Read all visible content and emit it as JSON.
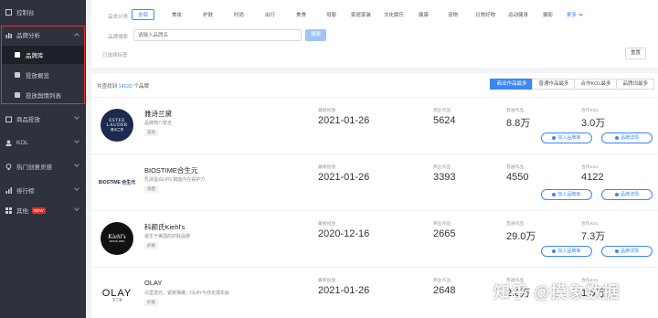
{
  "sidebar": {
    "items": [
      {
        "label": "控制台"
      },
      {
        "label": "品牌分析"
      },
      {
        "label": "品牌库"
      },
      {
        "label": "投放概览"
      },
      {
        "label": "投放舆情列表"
      },
      {
        "label": "商品投放"
      },
      {
        "label": "KOL"
      },
      {
        "label": "热门创意灵感"
      },
      {
        "label": "排行榜"
      },
      {
        "label": "其他",
        "badge": "NEW"
      }
    ]
  },
  "filters": {
    "category_label": "品类分类",
    "categories": [
      "全部",
      "美妆",
      "护肤",
      "时尚",
      "出行",
      "美食",
      "母婴",
      "家居家装",
      "文化娱乐",
      "健康",
      "宠物",
      "日常好物",
      "运动健身",
      "摄影"
    ],
    "more": "更多",
    "search_label": "品牌搜索",
    "search_placeholder": "请输入品牌名",
    "search_button": "搜索",
    "selected_label": "已选择标签",
    "reset_button": "重置"
  },
  "list": {
    "count_prefix": "共查找到",
    "count": "14032",
    "count_suffix": "个品牌",
    "sort_buttons": [
      "商业作品最多",
      "普通作品最多",
      "合作KOL最多",
      "品牌词最多"
    ],
    "stat_labels": [
      "最新投放",
      "商业作品",
      "普通作品",
      "合作KOL"
    ],
    "btn_add": "加入品牌库",
    "btn_detail": "品牌详情",
    "rows": [
      {
        "name": "雅诗兰黛",
        "desc": "品牌简介暂无",
        "tag": "美妆",
        "logo_line1": "ESTEE",
        "logo_line2": "LAUDER",
        "logo_line3": "雅诗兰黛",
        "latest": "2021-01-26",
        "commercial": "5624",
        "normal": "8.8万",
        "kol": "3.0万"
      },
      {
        "name": "BIOSTIME合生元",
        "desc": "乳清蛋白LPN 赋能内在保护力",
        "tag": "母婴",
        "logo_line1": "BIOSTIME 合生元",
        "latest": "2021-01-26",
        "commercial": "3393",
        "normal": "4550",
        "kol": "4122"
      },
      {
        "name": "科颜氏Kiehl's",
        "desc": "诞生于美国的护肤品牌",
        "tag": "护肤",
        "logo_line1": "Kiehl's",
        "logo_line2": "SINCE 1851",
        "latest": "2020-12-16",
        "commercial": "2665",
        "normal": "29.0万",
        "kol": "7.3万"
      },
      {
        "name": "OLAY",
        "desc": "白里透光，紧致弹嫩，OLAY与你无惧年龄",
        "tag": "护肤",
        "logo_line1": "OLAY",
        "logo_line2": "玉兰油",
        "latest": "2021-01-26",
        "commercial": "2648",
        "normal": "2.8万",
        "kol": "1.5万"
      }
    ]
  },
  "watermark": "知乎 @摸象数据"
}
